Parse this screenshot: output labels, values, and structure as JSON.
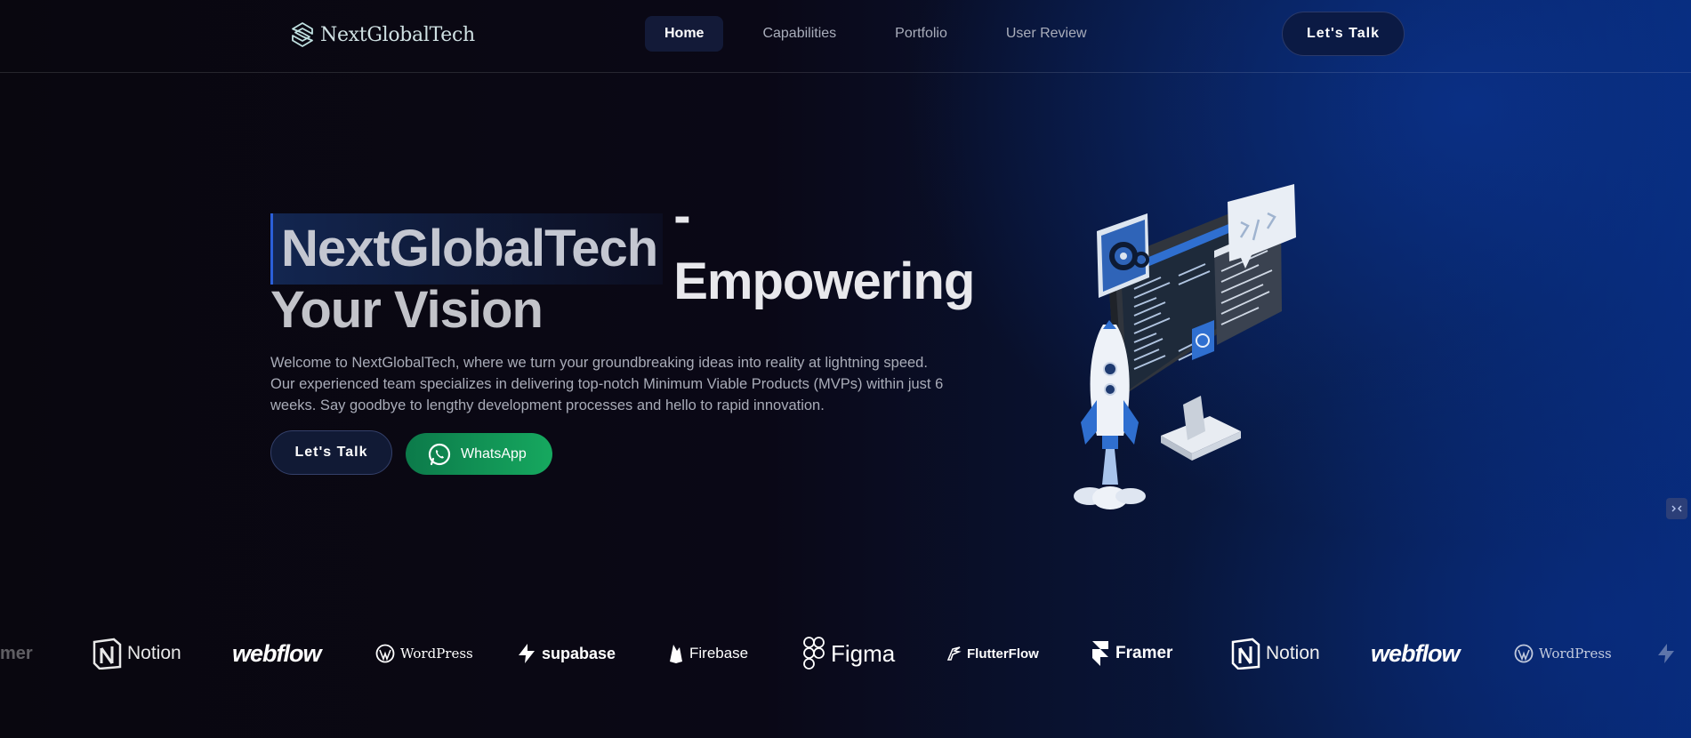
{
  "nav": {
    "logo_text": "NextGlobalTech",
    "items": [
      {
        "label": "Home",
        "active": true
      },
      {
        "label": "Capabilities",
        "active": false
      },
      {
        "label": "Portfolio",
        "active": false
      },
      {
        "label": "User Review",
        "active": false
      }
    ],
    "cta_label": "Let's Talk"
  },
  "hero": {
    "title_highlight": "NextGlobalTech",
    "title_rest": "- Empowering",
    "title_line2": "Your Vision",
    "description": "Welcome to NextGlobalTech, where we turn your groundbreaking ideas into reality at lightning speed. Our experienced team specializes in delivering top-notch Minimum Viable Products (MVPs) within just 6 weeks. Say goodbye to lengthy development processes and hello to rapid innovation.",
    "primary_button": "Let's Talk",
    "whatsapp_button": "WhatsApp"
  },
  "logos": {
    "partial_left": "mer",
    "items": [
      "Notion",
      "webflow",
      "WordPress",
      "supabase",
      "Firebase",
      "Figma",
      "FlutterFlow",
      "Framer",
      "Notion",
      "webflow",
      "WordPress"
    ]
  },
  "colors": {
    "accent_blue": "#2b5fd9",
    "whatsapp_green": "#16a85f",
    "bg_dark": "#09070f",
    "bg_blue": "#072a78"
  }
}
